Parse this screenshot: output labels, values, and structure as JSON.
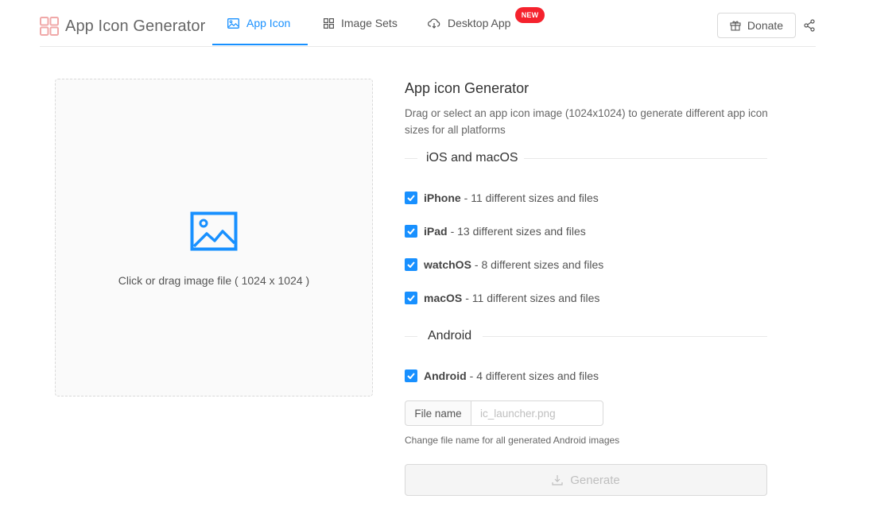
{
  "app": {
    "title": "App Icon Generator",
    "logo_icon": "grid-logo-icon"
  },
  "nav": {
    "tabs": [
      {
        "label": "App Icon",
        "icon": "image-icon",
        "active": true
      },
      {
        "label": "Image Sets",
        "icon": "grid-icon",
        "active": false
      },
      {
        "label": "Desktop App",
        "icon": "cloud-download-icon",
        "active": false,
        "badge": "NEW"
      }
    ],
    "donate_label": "Donate",
    "donate_icon": "gift-icon",
    "share_icon": "share-icon"
  },
  "upload": {
    "text": "Click or drag image file ( 1024 x 1024 )",
    "icon": "picture-icon"
  },
  "panel": {
    "title": "App icon Generator",
    "description": "Drag or select an app icon image (1024x1024) to generate different app icon sizes for all platforms",
    "sections": {
      "ios": {
        "heading": "iOS and macOS",
        "options": [
          {
            "name": "iPhone",
            "detail": "- 11 different sizes and files",
            "checked": true
          },
          {
            "name": "iPad",
            "detail": "- 13 different sizes and files",
            "checked": true
          },
          {
            "name": "watchOS",
            "detail": "- 8 different sizes and files",
            "checked": true
          },
          {
            "name": "macOS",
            "detail": "- 11 different sizes and files",
            "checked": true
          }
        ]
      },
      "android": {
        "heading": "Android",
        "options": [
          {
            "name": "Android",
            "detail": "- 4 different sizes and files",
            "checked": true
          }
        ]
      }
    },
    "file_name": {
      "label": "File name",
      "placeholder": "ic_launcher.png",
      "value": "",
      "hint": "Change file name for all generated Android images"
    },
    "generate_label": "Generate",
    "generate_icon": "download-icon"
  },
  "colors": {
    "accent": "#1890ff",
    "badge": "#f5222d",
    "logo": "#f0a8a8"
  }
}
